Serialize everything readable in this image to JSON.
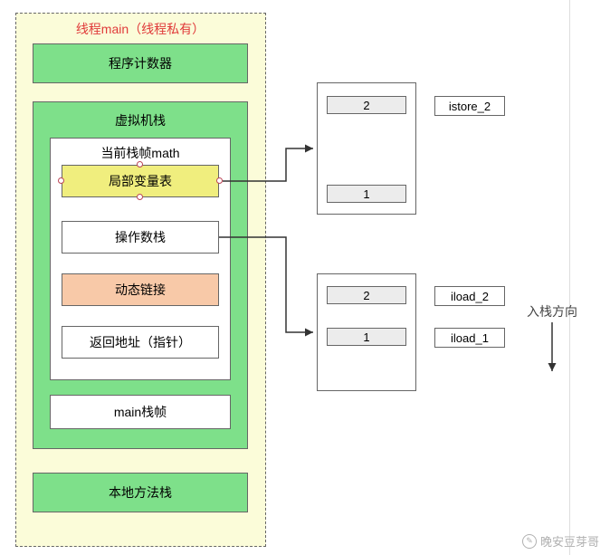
{
  "thread_box": {
    "title": "线程main（线程私有）"
  },
  "green_blocks": {
    "program_counter": "程序计数器",
    "vm_stack": "虚拟机栈",
    "native_stack": "本地方法栈"
  },
  "frame": {
    "current_title": "当前栈帧math",
    "local_vars": "局部变量表",
    "operand_stack": "操作数栈",
    "dynamic_link": "动态链接",
    "return_addr": "返回地址（指针）",
    "main_frame": "main栈帧"
  },
  "stack_box_top": {
    "slot_top": "2",
    "slot_bottom": "1",
    "instr_top": "istore_2"
  },
  "stack_box_bottom": {
    "slot_top": "2",
    "slot_bottom": "1",
    "instr_top": "iload_2",
    "instr_bottom": "iload_1"
  },
  "push_label": "入栈方向",
  "watermark": "晚安豆芽哥"
}
